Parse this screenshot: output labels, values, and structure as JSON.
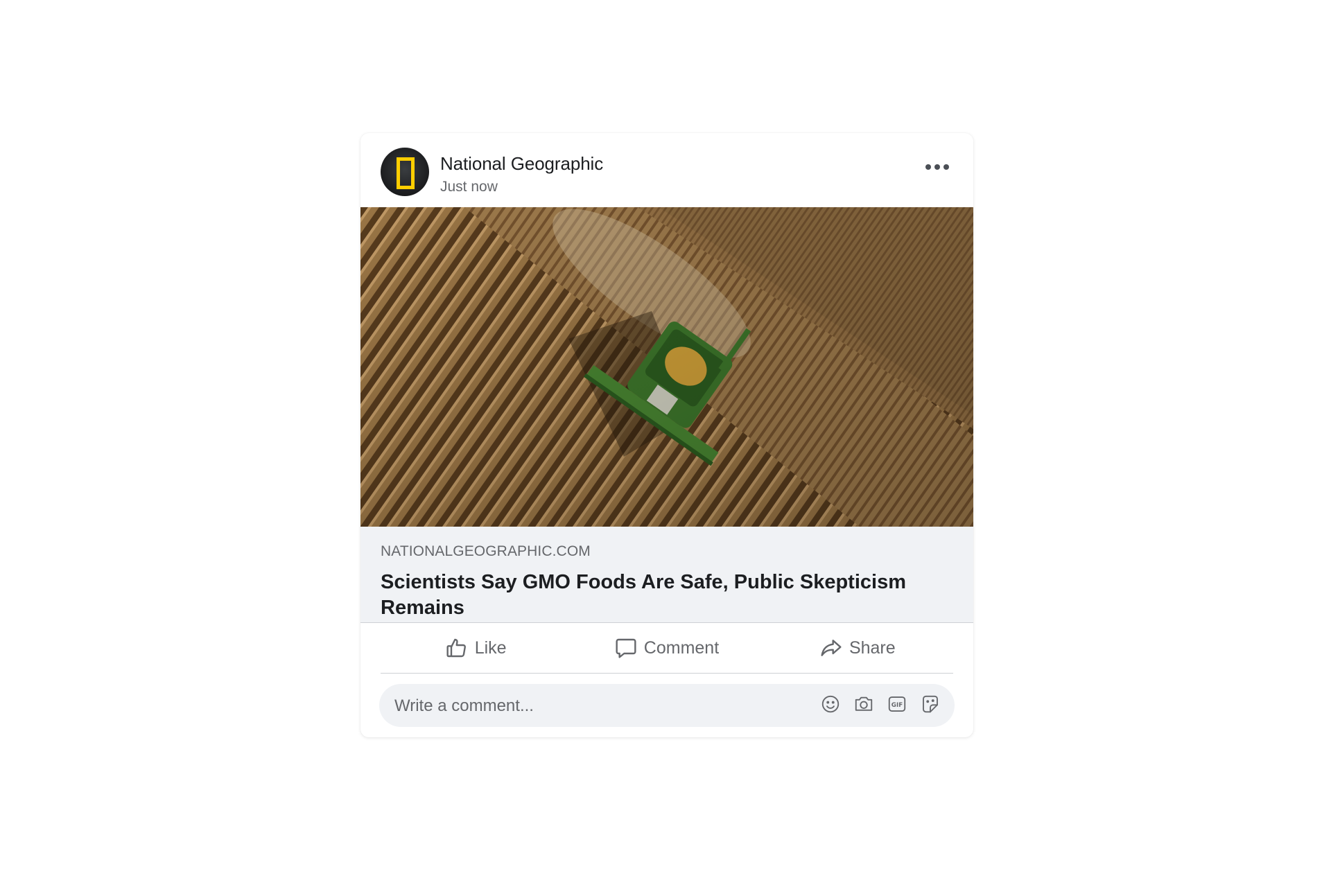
{
  "post": {
    "page_name": "National Geographic",
    "timestamp": "Just now",
    "more_icon": "more-horizontal-icon",
    "photo_alt_subject": "combine harvester in corn field",
    "link": {
      "domain": "NATIONALGEOGRAPHIC.COM",
      "title": "Scientists Say GMO Foods Are Safe, Public Skepticism Remains"
    }
  },
  "actions": {
    "like_label": "Like",
    "comment_label": "Comment",
    "share_label": "Share"
  },
  "comment_box": {
    "placeholder": "Write a comment...",
    "icons": [
      "emoji-icon",
      "camera-icon",
      "gif-icon",
      "sticker-icon"
    ]
  },
  "colors": {
    "text_primary": "#1c1e21",
    "text_secondary": "#65676b",
    "preview_bg": "#f0f2f5",
    "logo_yellow": "#ffce00"
  }
}
